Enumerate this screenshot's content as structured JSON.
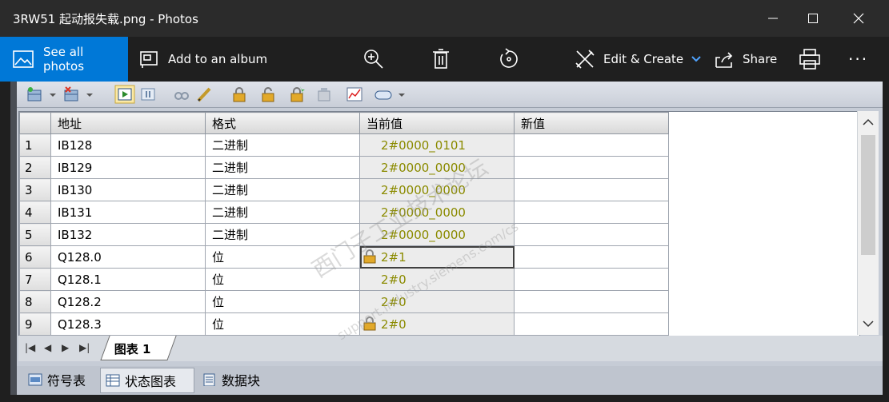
{
  "window": {
    "title": "3RW51 起动报失载.png - Photos"
  },
  "toolbar": {
    "see_all_photos": "See all photos",
    "add_to_album": "Add to an album",
    "edit_create": "Edit & Create",
    "share": "Share"
  },
  "table": {
    "headers": [
      "地址",
      "格式",
      "当前值",
      "新值"
    ],
    "rows": [
      {
        "no": "1",
        "address": "IB128",
        "format": "二进制",
        "current": "2#0000_0101",
        "new": "",
        "locked": false
      },
      {
        "no": "2",
        "address": "IB129",
        "format": "二进制",
        "current": "2#0000_0000",
        "new": "",
        "locked": false
      },
      {
        "no": "3",
        "address": "IB130",
        "format": "二进制",
        "current": "2#0000_0000",
        "new": "",
        "locked": false
      },
      {
        "no": "4",
        "address": "IB131",
        "format": "二进制",
        "current": "2#0000_0000",
        "new": "",
        "locked": false
      },
      {
        "no": "5",
        "address": "IB132",
        "format": "二进制",
        "current": "2#0000_0000",
        "new": "",
        "locked": false
      },
      {
        "no": "6",
        "address": "Q128.0",
        "format": "位",
        "current": "2#1",
        "new": "",
        "locked": true
      },
      {
        "no": "7",
        "address": "Q128.1",
        "format": "位",
        "current": "2#0",
        "new": "",
        "locked": false
      },
      {
        "no": "8",
        "address": "Q128.2",
        "format": "位",
        "current": "2#0",
        "new": "",
        "locked": false
      },
      {
        "no": "9",
        "address": "Q128.3",
        "format": "位",
        "current": "2#0",
        "new": "",
        "locked": true
      }
    ]
  },
  "sheet_tab": "图表 1",
  "bottom_tabs": [
    {
      "label": "符号表"
    },
    {
      "label": "状态图表"
    },
    {
      "label": "数据块"
    }
  ],
  "watermark": {
    "line1": "西门子工业技术论坛",
    "line2": "support.industry.siemens.com/cs"
  },
  "colors": {
    "accent": "#0078d7",
    "current_value_text": "#8b8b00"
  }
}
